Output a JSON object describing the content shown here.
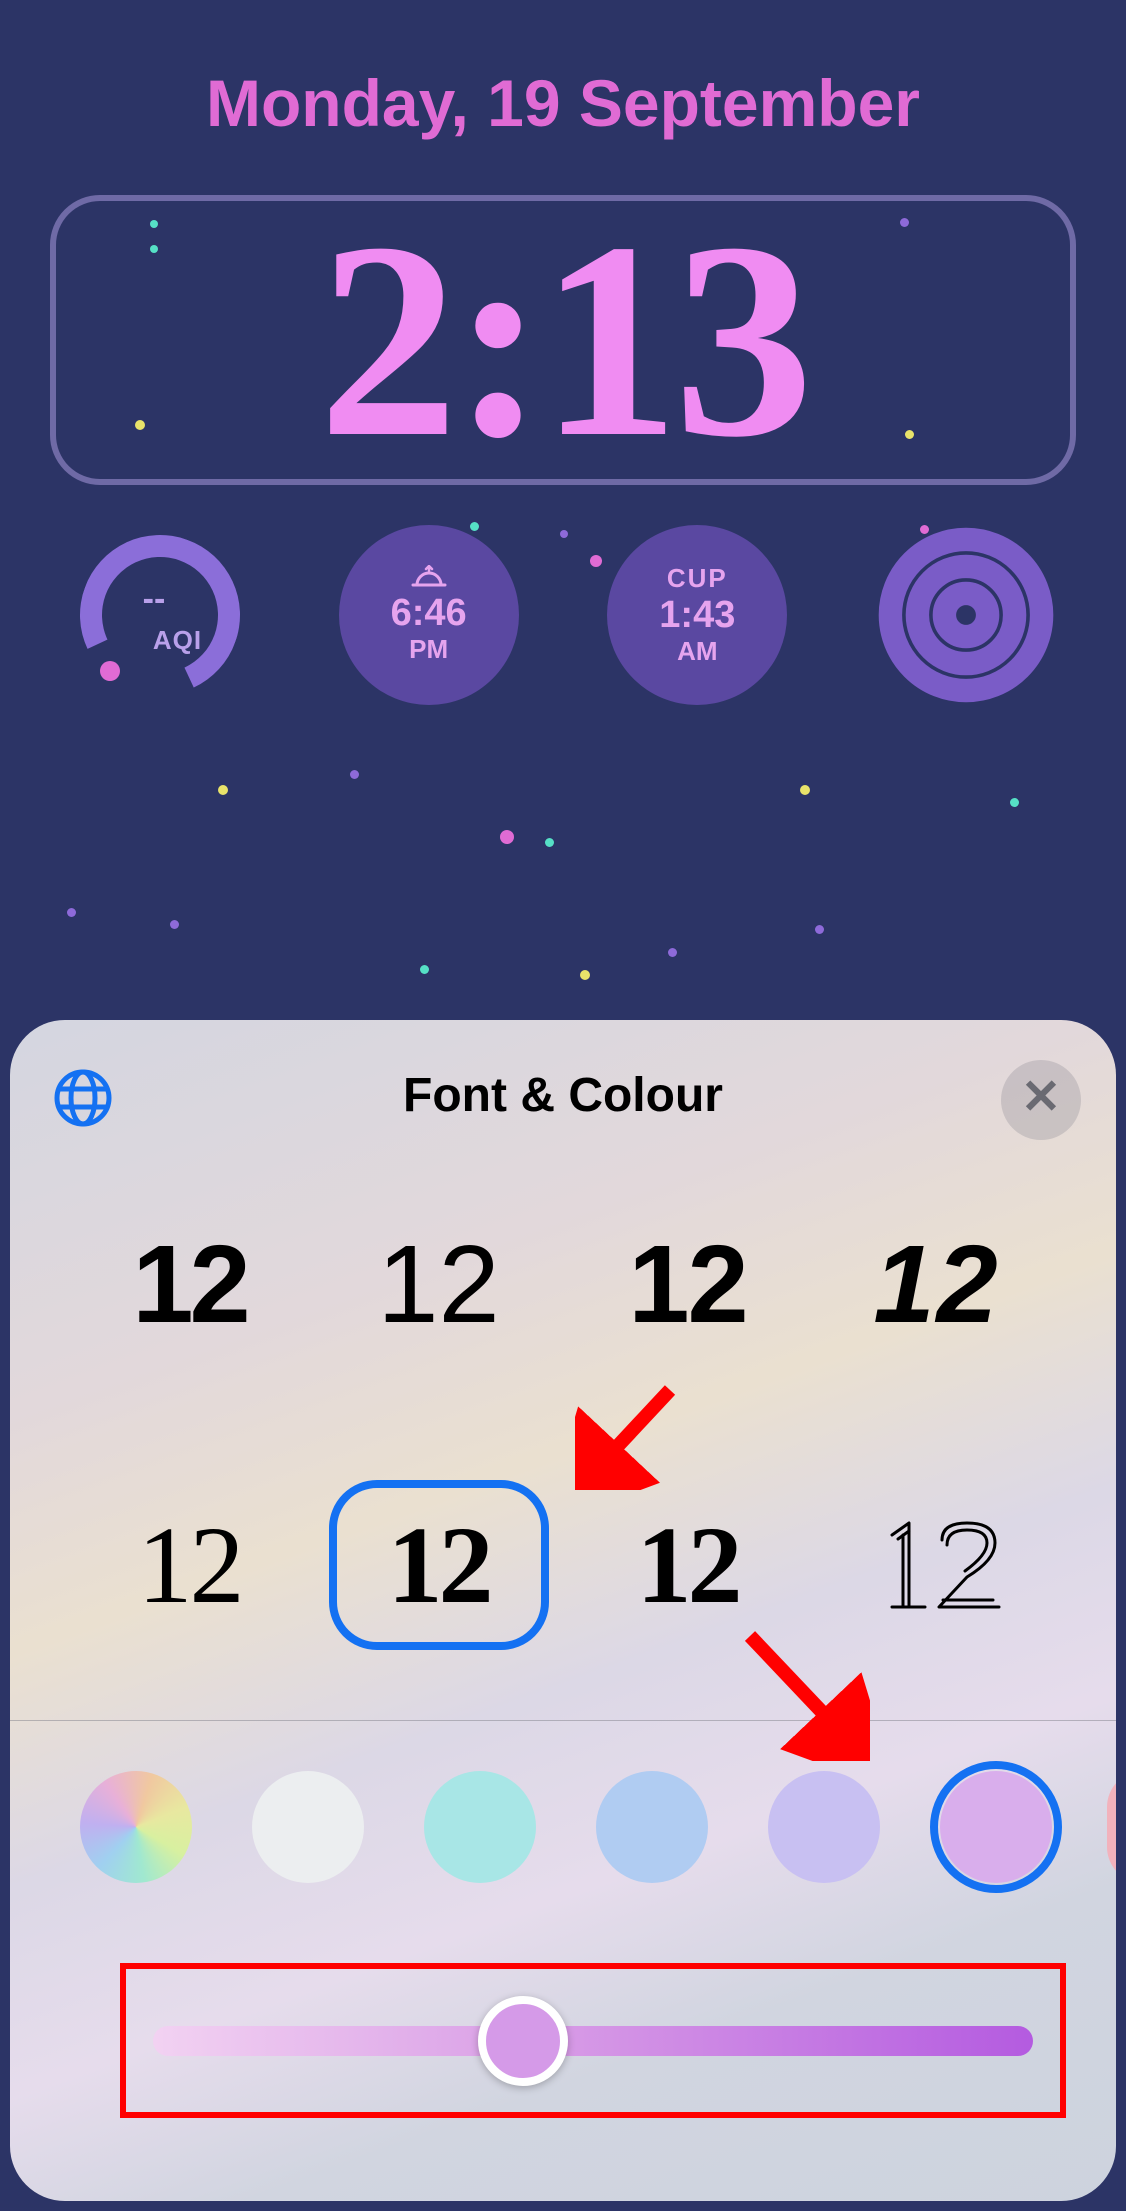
{
  "lock_screen": {
    "date": "Monday, 19 September",
    "time": "2:13",
    "widgets": {
      "aqi": {
        "value": "--",
        "label": "AQI"
      },
      "sunset": {
        "time": "6:46",
        "period": "PM"
      },
      "world_clock": {
        "city": "CUP",
        "time": "1:43",
        "period": "AM"
      }
    }
  },
  "panel": {
    "title": "Font & Colour",
    "font_sample": "12",
    "font_options": [
      {
        "id": "f1",
        "selected": false
      },
      {
        "id": "f2",
        "selected": false
      },
      {
        "id": "f3",
        "selected": false
      },
      {
        "id": "f4",
        "selected": false
      },
      {
        "id": "f5",
        "selected": false
      },
      {
        "id": "f6",
        "selected": true
      },
      {
        "id": "f7",
        "selected": false
      },
      {
        "id": "f8",
        "selected": false
      }
    ],
    "colors": [
      {
        "id": "rainbow",
        "css": "conic-gradient(from 120deg, #d8f0a0, #a0e8d0, #a0d0f0, #c0b0f0, #e8b0d8, #f0c8a0, #e8e8a0, #d8f0a0)",
        "selected": false
      },
      {
        "id": "white",
        "css": "#eceef0",
        "selected": false
      },
      {
        "id": "mint",
        "css": "#a8e6e6",
        "selected": false
      },
      {
        "id": "sky",
        "css": "#b0ccf2",
        "selected": false
      },
      {
        "id": "lavender",
        "css": "#c8c0f2",
        "selected": false
      },
      {
        "id": "violet",
        "css": "#d9aeec",
        "selected": true
      },
      {
        "id": "pink",
        "css": "#f2b2bc",
        "selected": false,
        "partial": true
      }
    ],
    "slider_percent": 42
  }
}
